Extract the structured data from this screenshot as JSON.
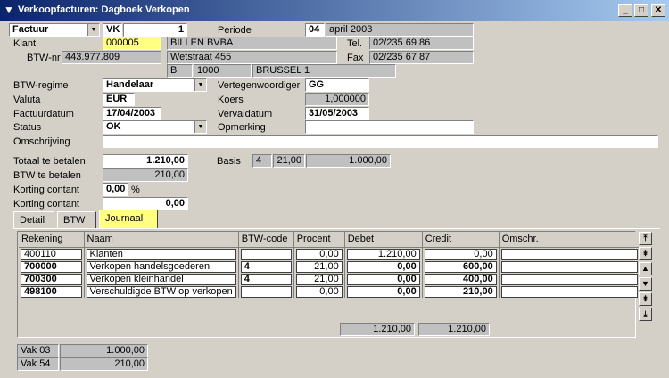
{
  "window": {
    "title": "Verkoopfacturen: Dagboek Verkopen",
    "minimize": "_",
    "maximize": "□",
    "close": "✕"
  },
  "header": {
    "doc_type": "Factuur",
    "journal": "VK",
    "number": "1",
    "period_label": "Periode",
    "period_num": "04",
    "period_text": "april 2003"
  },
  "client": {
    "label": "Klant",
    "code": "000005",
    "name": "BILLEN BVBA",
    "tel_label": "Tel.",
    "tel": "02/235 69 86",
    "vat_label": "BTW-nr",
    "vat": "443.977.809",
    "street": "Wetstraat 455",
    "fax_label": "Fax",
    "fax": "02/235 67 87",
    "country": "B",
    "postcode": "1000",
    "city": "BRUSSEL 1"
  },
  "form": {
    "btw_regime_label": "BTW-regime",
    "btw_regime": "Handelaar",
    "rep_label": "Vertegenwoordiger",
    "rep": "GG",
    "currency_label": "Valuta",
    "currency": "EUR",
    "rate_label": "Koers",
    "rate": "1,000000",
    "invoice_date_label": "Factuurdatum",
    "invoice_date": "17/04/2003",
    "due_date_label": "Vervaldatum",
    "due_date": "31/05/2003",
    "status_label": "Status",
    "status": "OK",
    "remark_label": "Opmerking",
    "remark": "",
    "description_label": "Omschrijving",
    "description": ""
  },
  "totals": {
    "total_label": "Totaal te betalen",
    "total": "1.210,00",
    "btw_label": "BTW te betalen",
    "btw": "210,00",
    "discount_label": "Korting contant",
    "discount_pct": "0,00",
    "pct_sign": "%",
    "discount2_label": "Korting contant",
    "discount_amount": "0,00",
    "basis_label": "Basis",
    "basis_code": "4",
    "basis_rate": "21,00",
    "basis_amount": "1.000,00"
  },
  "tabs": [
    "Detail",
    "BTW",
    "Journaal"
  ],
  "grid": {
    "columns": [
      "Rekening",
      "Naam",
      "BTW-code",
      "Procent",
      "Debet",
      "Credit",
      "Omschr."
    ],
    "rows": [
      {
        "rekening": "400110",
        "naam": "Klanten",
        "btw_code": "",
        "procent": "0,00",
        "debet": "1.210,00",
        "credit": "0,00",
        "omschr": ""
      },
      {
        "rekening": "700000",
        "naam": "Verkopen handelsgoederen",
        "btw_code": "4",
        "procent": "21,00",
        "debet": "0,00",
        "credit": "600,00",
        "omschr": ""
      },
      {
        "rekening": "700300",
        "naam": "Verkopen kleinhandel",
        "btw_code": "4",
        "procent": "21,00",
        "debet": "0,00",
        "credit": "400,00",
        "omschr": ""
      },
      {
        "rekening": "498100",
        "naam": "Verschuldigde BTW op verkopen",
        "btw_code": "",
        "procent": "0,00",
        "debet": "0,00",
        "credit": "210,00",
        "omschr": ""
      }
    ],
    "total_debet": "1.210,00",
    "total_credit": "1.210,00"
  },
  "vak": [
    {
      "label": "Vak 03",
      "value": "1.000,00"
    },
    {
      "label": "Vak 54",
      "value": "210,00"
    }
  ],
  "nav_icons": [
    "first-page-icon",
    "prev-page-icon",
    "up-icon",
    "down-icon",
    "next-page-icon",
    "last-page-icon"
  ],
  "colors": {
    "title_start": "#0a246a",
    "title_end": "#a6caf0",
    "highlight": "#ffff80",
    "face": "#d4d0c8"
  }
}
